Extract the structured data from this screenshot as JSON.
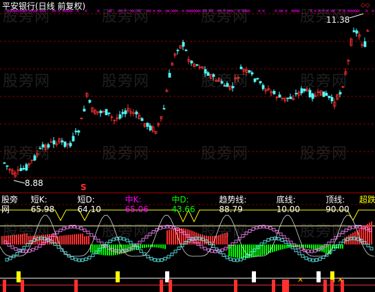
{
  "window": {
    "title": "平安银行(日线 前复权)"
  },
  "price_chart": {
    "high_label": "11.38",
    "low_label": "8.88",
    "signal_marker": "S"
  },
  "indicator": {
    "name": "股旁网",
    "items": [
      {
        "label": "短K: ",
        "value": "65.98",
        "color": "#ffffff"
      },
      {
        "label": "短D: ",
        "value": "64.10",
        "color": "#ffffff"
      },
      {
        "label": "中K: ",
        "value": "65.06",
        "color": "#ff00ff"
      },
      {
        "label": "中D: ",
        "value": "43.66",
        "color": "#00ff00"
      },
      {
        "label": "趋势线: ",
        "value": "88.79",
        "color": "#ffffff"
      },
      {
        "label": "底线: ",
        "value": "10.00",
        "color": "#ffffff"
      },
      {
        "label": "顶线: ",
        "value": "90.00",
        "color": "#ffffff"
      }
    ],
    "overflow_label": "超跌"
  },
  "watermark": "股旁网",
  "colors": {
    "background": "#000000",
    "up": "#ff3030",
    "down": "#54ffff",
    "grid": "#8b0000",
    "marker": "#ff00ff",
    "yellow": "#ffff00",
    "green": "#00ff00"
  }
}
